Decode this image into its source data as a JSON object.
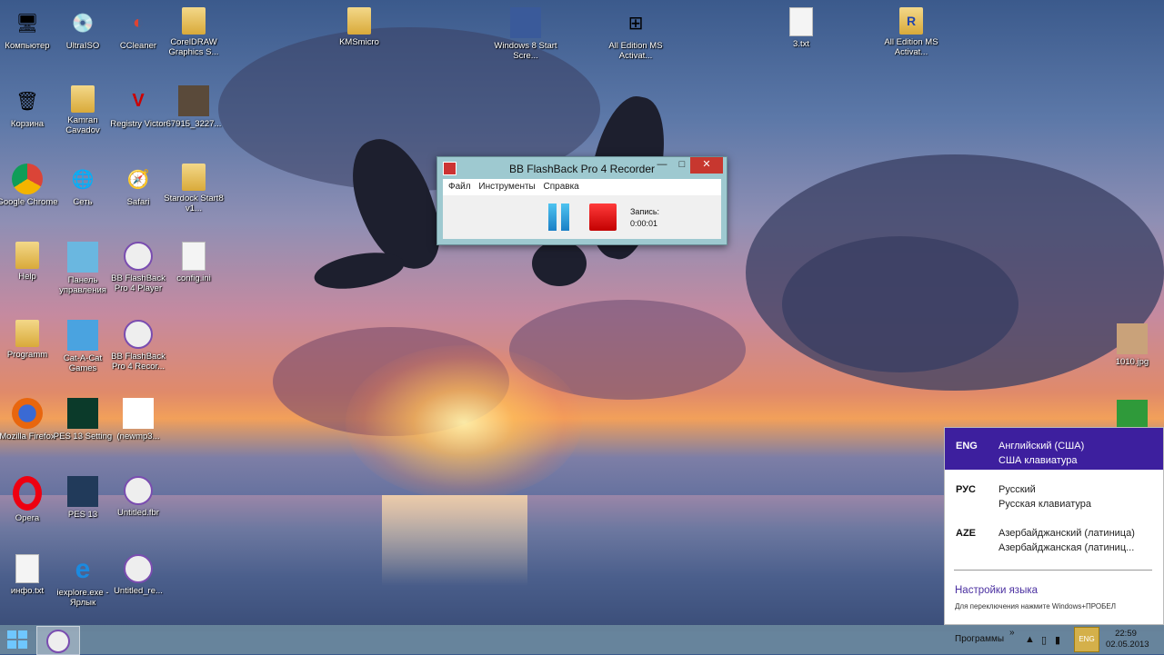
{
  "desktop_icons": [
    {
      "label": "Компьютер",
      "icon": "computer-icon"
    },
    {
      "label": "UltraISO",
      "icon": "disc-icon"
    },
    {
      "label": "CCleaner",
      "icon": "ccleaner-icon"
    },
    {
      "label": "CorelDRAW Graphics S...",
      "icon": "folder-icon"
    },
    {
      "label": "KMSmicro",
      "icon": "folder-icon"
    },
    {
      "label": "Windows 8 Start Scre...",
      "icon": "start-screen-icon"
    },
    {
      "label": "All Edition MS Activat...",
      "icon": "windows-flag-icon"
    },
    {
      "label": "3.txt",
      "icon": "text-file-icon"
    },
    {
      "label": "All Edition MS Activat...",
      "icon": "archive-icon"
    },
    {
      "label": "Корзина",
      "icon": "recycle-bin-icon"
    },
    {
      "label": "Kamran Cavadov",
      "icon": "user-folder-icon"
    },
    {
      "label": "Registry Victor",
      "icon": "registry-icon"
    },
    {
      "label": "67915_3227...",
      "icon": "image-icon"
    },
    {
      "label": "Google Chrome",
      "icon": "chrome-icon"
    },
    {
      "label": "Сеть",
      "icon": "network-icon"
    },
    {
      "label": "Safari",
      "icon": "safari-icon"
    },
    {
      "label": "Stardock Start8 v1...",
      "icon": "folder-icon"
    },
    {
      "label": "Help",
      "icon": "folder-icon"
    },
    {
      "label": "Панель управления",
      "icon": "control-panel-icon"
    },
    {
      "label": "BB FlashBack Pro 4 Player",
      "icon": "flashback-player-icon"
    },
    {
      "label": "config.ini",
      "icon": "config-file-icon"
    },
    {
      "label": "Programm",
      "icon": "folder-icon"
    },
    {
      "label": "Cat-A-Cat Games",
      "icon": "game-icon"
    },
    {
      "label": "BB FlashBack Pro 4 Recor...",
      "icon": "flashback-recorder-icon"
    },
    {
      "label": "Mozilla Firefox",
      "icon": "firefox-icon"
    },
    {
      "label": "PES 13 Setting",
      "icon": "pes-icon"
    },
    {
      "label": "(newmp3...",
      "icon": "mp3-icon"
    },
    {
      "label": "Opera",
      "icon": "opera-icon"
    },
    {
      "label": "PES 13",
      "icon": "pes-icon"
    },
    {
      "label": "Untitled.fbr",
      "icon": "fbr-file-icon"
    },
    {
      "label": "инфо.txt",
      "icon": "text-file-icon"
    },
    {
      "label": "iexplore.exe - Ярлык",
      "icon": "ie-icon"
    },
    {
      "label": "Untitled_re...",
      "icon": "fbr-file-icon"
    },
    {
      "label": "1010.jpg",
      "icon": "image-icon"
    },
    {
      "label": "",
      "icon": "green-image-icon"
    }
  ],
  "recorder": {
    "title": "BB FlashBack Pro 4 Recorder",
    "menu": [
      "Файл",
      "Инструменты",
      "Справка"
    ],
    "record_label": "Запись:",
    "record_time": "0:00:01"
  },
  "language_flyout": {
    "languages": [
      {
        "code": "ENG",
        "name": "Английский (США)",
        "keyboard": "США клавиатура",
        "selected": true
      },
      {
        "code": "РУС",
        "name": "Русский",
        "keyboard": "Русская клавиатура",
        "selected": false
      },
      {
        "code": "AZE",
        "name": "Азербайджанский (латиница)",
        "keyboard": "Азербайджанская (латиниц...",
        "selected": false
      }
    ],
    "settings_link": "Настройки языка",
    "hint": "Для переключения нажмите Windows+ПРОБЕЛ"
  },
  "taskbar": {
    "programs_label": "Программы",
    "chevron": "»",
    "input_indicator": "ENG",
    "time": "22:59",
    "date": "02.05.2013"
  },
  "colors": {
    "flyout_selected": "#3d1f9e",
    "recorder_frame": "#9ec9d0",
    "stop_red": "#e01010",
    "pause_blue": "#2a9be0"
  }
}
